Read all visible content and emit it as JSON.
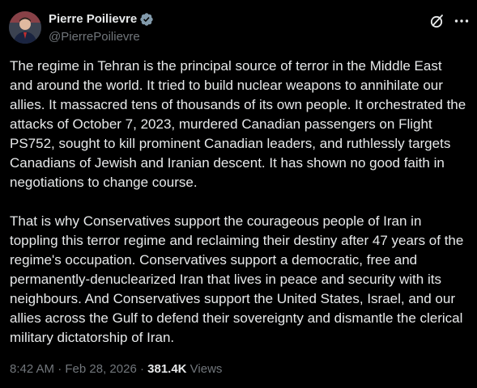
{
  "author": {
    "display_name": "Pierre Poilievre",
    "handle": "@PierrePoilievre",
    "verified": true,
    "verified_color": "#829aab"
  },
  "icons": {
    "avatar": "avatar",
    "verified": "verified-badge-icon",
    "grok": "grok-icon",
    "more": "more-icon"
  },
  "tweet": {
    "paragraphs": [
      "The regime in Tehran is the principal source of terror in the Middle East and around the world. It tried to build nuclear weapons to annihilate our allies. It massacred tens of thousands of its own people. It orchestrated the attacks of October 7, 2023, murdered Canadian passengers on Flight PS752, sought to kill prominent Canadian leaders, and ruthlessly targets Canadians of Jewish and Iranian descent. It has shown no good faith in negotiations to change course.",
      "That is why Conservatives support the courageous people of Iran in toppling this terror regime and reclaiming their destiny after 47 years of the regime's occupation. Conservatives support a democratic, free and permanently-denuclearized Iran that lives in peace and security with its neighbours. And Conservatives support the United States, Israel, and our allies across the Gulf to defend their sovereignty and dismantle the clerical military dictatorship of Iran."
    ]
  },
  "meta": {
    "time": "8:42 AM",
    "separator": " · ",
    "date": "Feb 28, 2026",
    "views_count": "381.4K",
    "views_label": " Views"
  },
  "colors": {
    "background": "#000000",
    "text": "#e7e9ea",
    "secondary": "#71767b"
  }
}
